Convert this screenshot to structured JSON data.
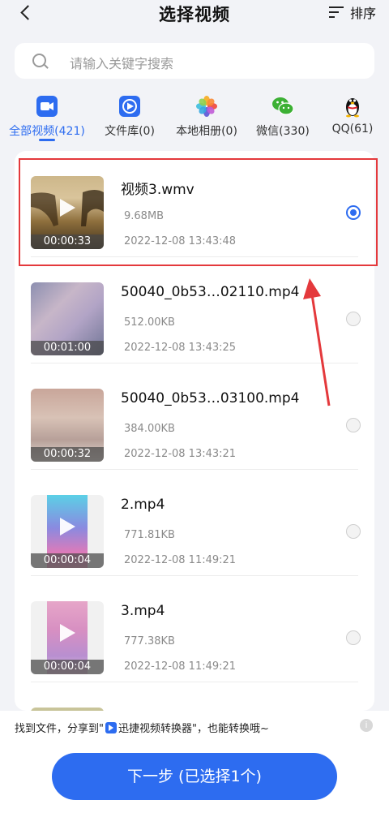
{
  "header": {
    "title": "选择视频",
    "sort_label": "排序"
  },
  "search": {
    "placeholder": "请输入关键字搜索"
  },
  "tabs": [
    {
      "label": "全部视频(421)",
      "icon": "video-camera-icon",
      "active": true
    },
    {
      "label": "文件库(0)",
      "icon": "file-library-icon",
      "active": false
    },
    {
      "label": "本地相册(0)",
      "icon": "photos-flower-icon",
      "active": false
    },
    {
      "label": "微信(330)",
      "icon": "wechat-icon",
      "active": false
    },
    {
      "label": "QQ(61)",
      "icon": "qq-penguin-icon",
      "active": false
    }
  ],
  "videos": [
    {
      "name": "视频3.wmv",
      "size": "9.68MB",
      "date": "2022-12-08 13:43:48",
      "duration": "00:00:33",
      "selected": true
    },
    {
      "name": "50040_0b53…02110.mp4",
      "size": "512.00KB",
      "date": "2022-12-08 13:43:25",
      "duration": "00:01:00",
      "selected": false
    },
    {
      "name": "50040_0b53…03100.mp4",
      "size": "384.00KB",
      "date": "2022-12-08 13:43:21",
      "duration": "00:00:32",
      "selected": false
    },
    {
      "name": "2.mp4",
      "size": "771.81KB",
      "date": "2022-12-08 11:49:21",
      "duration": "00:00:04",
      "selected": false
    },
    {
      "name": "3.mp4",
      "size": "777.38KB",
      "date": "2022-12-08 11:49:21",
      "duration": "00:00:04",
      "selected": false
    }
  ],
  "footer": {
    "hint_prefix": "找到文件，分享到\"",
    "hint_app": "迅捷视频转换器",
    "hint_suffix": "\"，也能转换哦~",
    "info_icon": "i",
    "next_label": "下一步 (已选择1个)"
  },
  "colors": {
    "accent": "#2d6cf0",
    "highlight": "#e4393c",
    "background": "#f2f3f7"
  }
}
